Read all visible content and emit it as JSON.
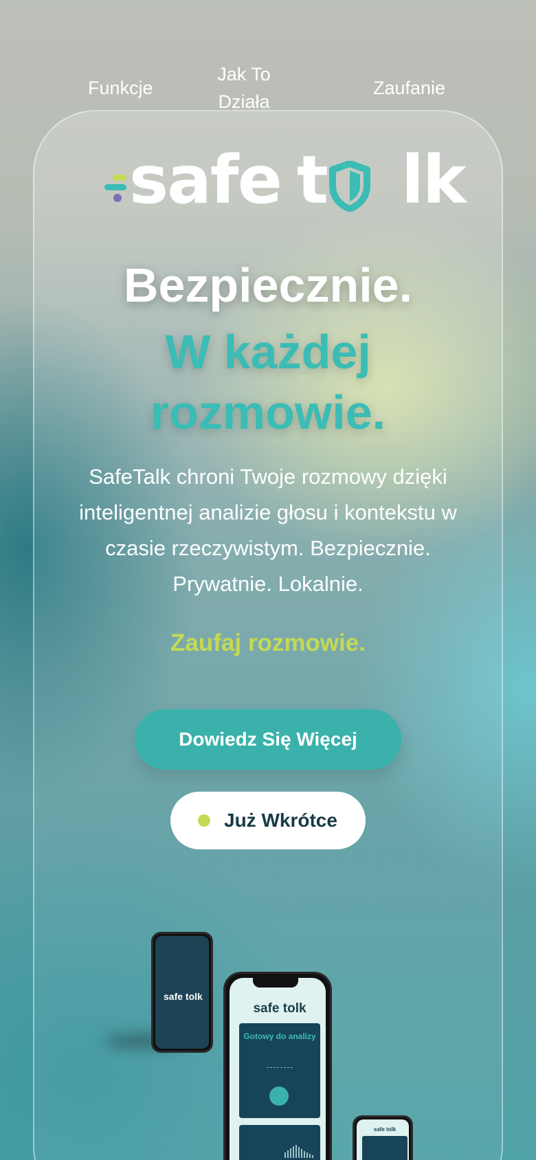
{
  "nav": {
    "items": [
      {
        "label": "Funkcje"
      },
      {
        "label": "Jak To Działa"
      },
      {
        "label": "Zaufanie"
      }
    ]
  },
  "logo": {
    "part1": "safe",
    "part2": "t",
    "part3": "lk",
    "colors": {
      "teal": "#3bbcb5",
      "lime": "#c4d955",
      "purple": "#7b6fb0",
      "white": "#ffffff"
    }
  },
  "hero": {
    "title_line1": "Bezpiecznie.",
    "title_line2": "W każdej rozmowie.",
    "description": "SafeTalk chroni Twoje rozmowy dzięki inteligentnej analizie głosu i kontekstu w czasie rzeczywistym. Bezpiecznie. Prywatnie. Lokalnie.",
    "tagline": "Zaufaj rozmowie.",
    "primary_button": "Dowiedz Się Więcej",
    "soon_button": "Już Wkrótce"
  },
  "mockups": {
    "phone_small_brand": "safe tolk",
    "phone_main_brand": "safe tolk",
    "phone_main_panel_title": "Gotowy do analizy",
    "phone_tiny_brand": "safe tolk"
  }
}
